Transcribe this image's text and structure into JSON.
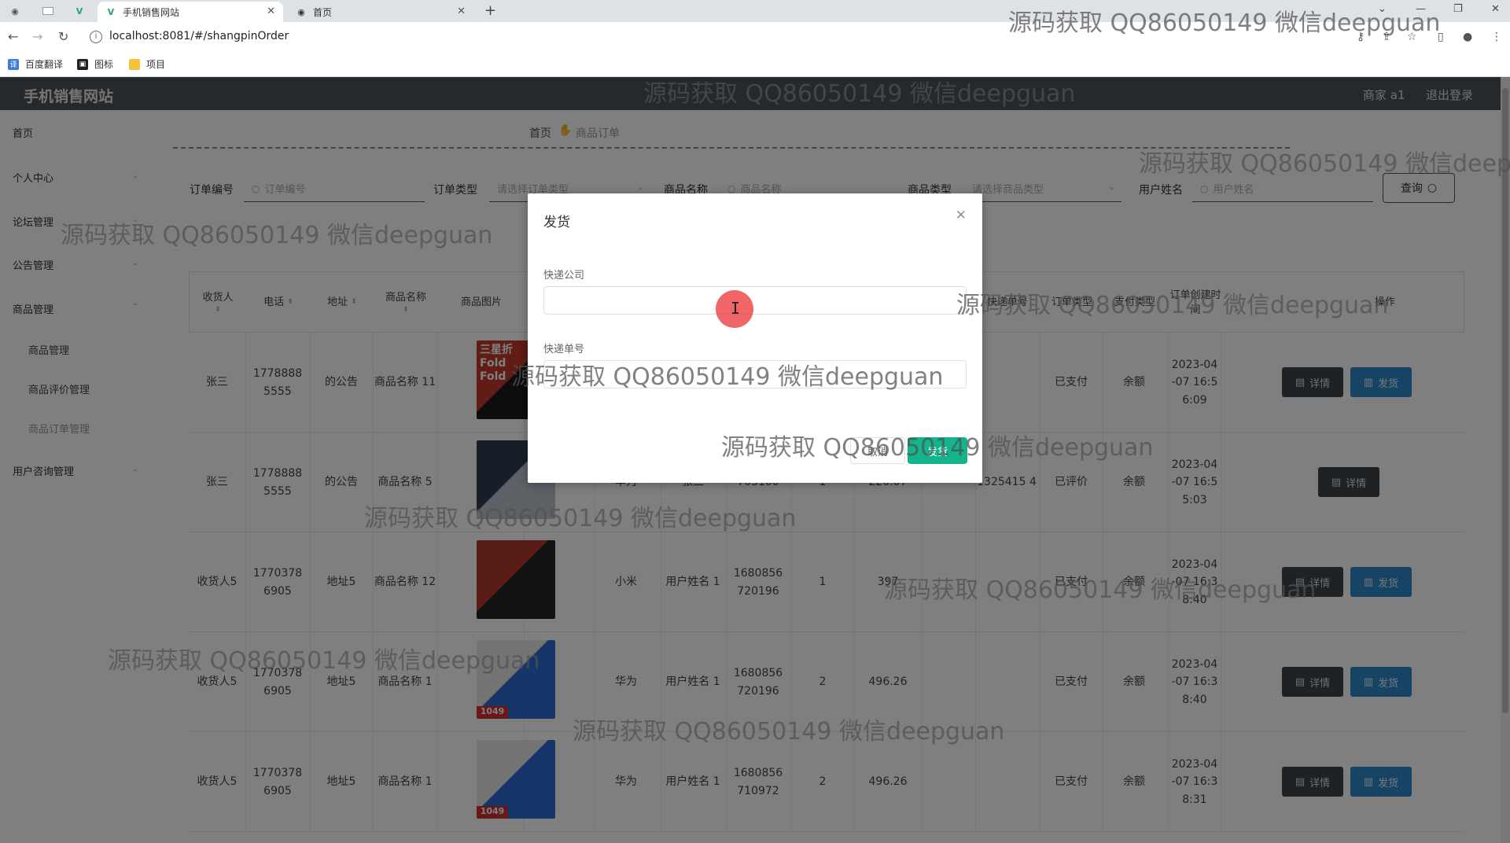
{
  "browser": {
    "tabs": [
      {
        "title": "手机销售网站",
        "active": true
      },
      {
        "title": "首页",
        "active": false
      }
    ],
    "url": "localhost:8081/#/shangpinOrder",
    "bookmarks": [
      "百度翻译",
      "图标",
      "项目"
    ]
  },
  "header": {
    "app_title": "手机销售网站",
    "user_label": "商家 a1",
    "logout": "退出登录"
  },
  "sidebar": {
    "items": [
      {
        "label": "首页"
      },
      {
        "label": "个人中心"
      },
      {
        "label": "论坛管理"
      },
      {
        "label": "公告管理"
      },
      {
        "label": "商品管理"
      },
      {
        "label": "商品管理"
      },
      {
        "label": "商品评价管理"
      },
      {
        "label": "商品订单管理"
      },
      {
        "label": "用户咨询管理"
      }
    ]
  },
  "breadcrumb": {
    "home": "首页",
    "current": "商品订单"
  },
  "filters": {
    "order_no_label": "订单编号",
    "order_no_placeholder": "订单编号",
    "order_type_label": "订单类型",
    "order_type_placeholder": "请选择订单类型",
    "product_name_label": "商品名称",
    "product_name_placeholder": "商品名称",
    "product_type_label": "商品类型",
    "product_type_placeholder": "请选择商品类型",
    "user_name_label": "用户姓名",
    "user_name_placeholder": "用户姓名",
    "query_button": "查询"
  },
  "table": {
    "headers": {
      "receiver": "收货人",
      "phone": "电话",
      "address": "地址",
      "product_name": "商品名称",
      "product_image": "商品图片",
      "express_no": "快递单号",
      "order_type": "订单类型",
      "pay_type": "支付类型",
      "create_time": "订单创建时间",
      "actions": "操作"
    },
    "rows": [
      {
        "receiver": "张三",
        "phone": "1778888 5555",
        "address": "的公告",
        "product_name": "商品名称 11",
        "brand": "",
        "user_name": "",
        "order_no": "",
        "qty": "",
        "price": "",
        "express_no": "",
        "order_type": "已支付",
        "pay_type": "余额",
        "create_time": "2023-04 -07 16:5 6:09",
        "detail": "详情",
        "ship": "发货"
      },
      {
        "receiver": "张三",
        "phone": "1778888 5555",
        "address": "的公告",
        "product_name": "商品名称 5",
        "brand": "华为",
        "user_name": "张三",
        "order_no": "703100",
        "qty": "1",
        "price": "220.07",
        "express_no": "1325415 4",
        "order_type": "已评价",
        "pay_type": "余额",
        "create_time": "2023-04 -07 16:5 5:03",
        "detail": "详情",
        "ship": ""
      },
      {
        "receiver": "收货人5",
        "phone": "1770378 6905",
        "address": "地址5",
        "product_name": "商品名称 12",
        "brand": "小米",
        "user_name": "用户姓名 1",
        "order_no": "1680856 720196",
        "qty": "1",
        "price": "397",
        "express_no": "",
        "order_type": "已支付",
        "pay_type": "余额",
        "create_time": "2023-04 -07 16:3 8:40",
        "detail": "详情",
        "ship": "发货"
      },
      {
        "receiver": "收货人5",
        "phone": "1770378 6905",
        "address": "地址5",
        "product_name": "商品名称 1",
        "brand": "华为",
        "user_name": "用户姓名 1",
        "order_no": "1680856 720196",
        "qty": "2",
        "price": "496.26",
        "express_no": "",
        "order_type": "已支付",
        "pay_type": "余额",
        "create_time": "2023-04 -07 16:3 8:40",
        "detail": "详情",
        "ship": "发货"
      },
      {
        "receiver": "收货人5",
        "phone": "1770378 6905",
        "address": "地址5",
        "product_name": "商品名称 1",
        "brand": "华为",
        "user_name": "用户姓名 1",
        "order_no": "1680856 710972",
        "qty": "2",
        "price": "496.26",
        "express_no": "",
        "order_type": "已支付",
        "pay_type": "余额",
        "create_time": "2023-04 -07 16:3 8:31",
        "detail": "详情",
        "ship": "发货"
      }
    ]
  },
  "dialog": {
    "title": "发货",
    "company_label": "快递公司",
    "company_value": "",
    "tracking_label": "快递单号",
    "tracking_value": "",
    "cancel": "取消",
    "confirm": "发货"
  },
  "watermark": "源码获取 QQ86050149 微信deepguan",
  "thumb_texts": {
    "fold": "Fold",
    "samsung": "三星折",
    "price_tag": "1049"
  },
  "colors": {
    "header_bg": "#4d5257",
    "ship_button": "#2e86c9",
    "detail_button": "#3f4448",
    "dialog_confirm": "#13b48b",
    "cursor_dot": "#ec4040"
  }
}
